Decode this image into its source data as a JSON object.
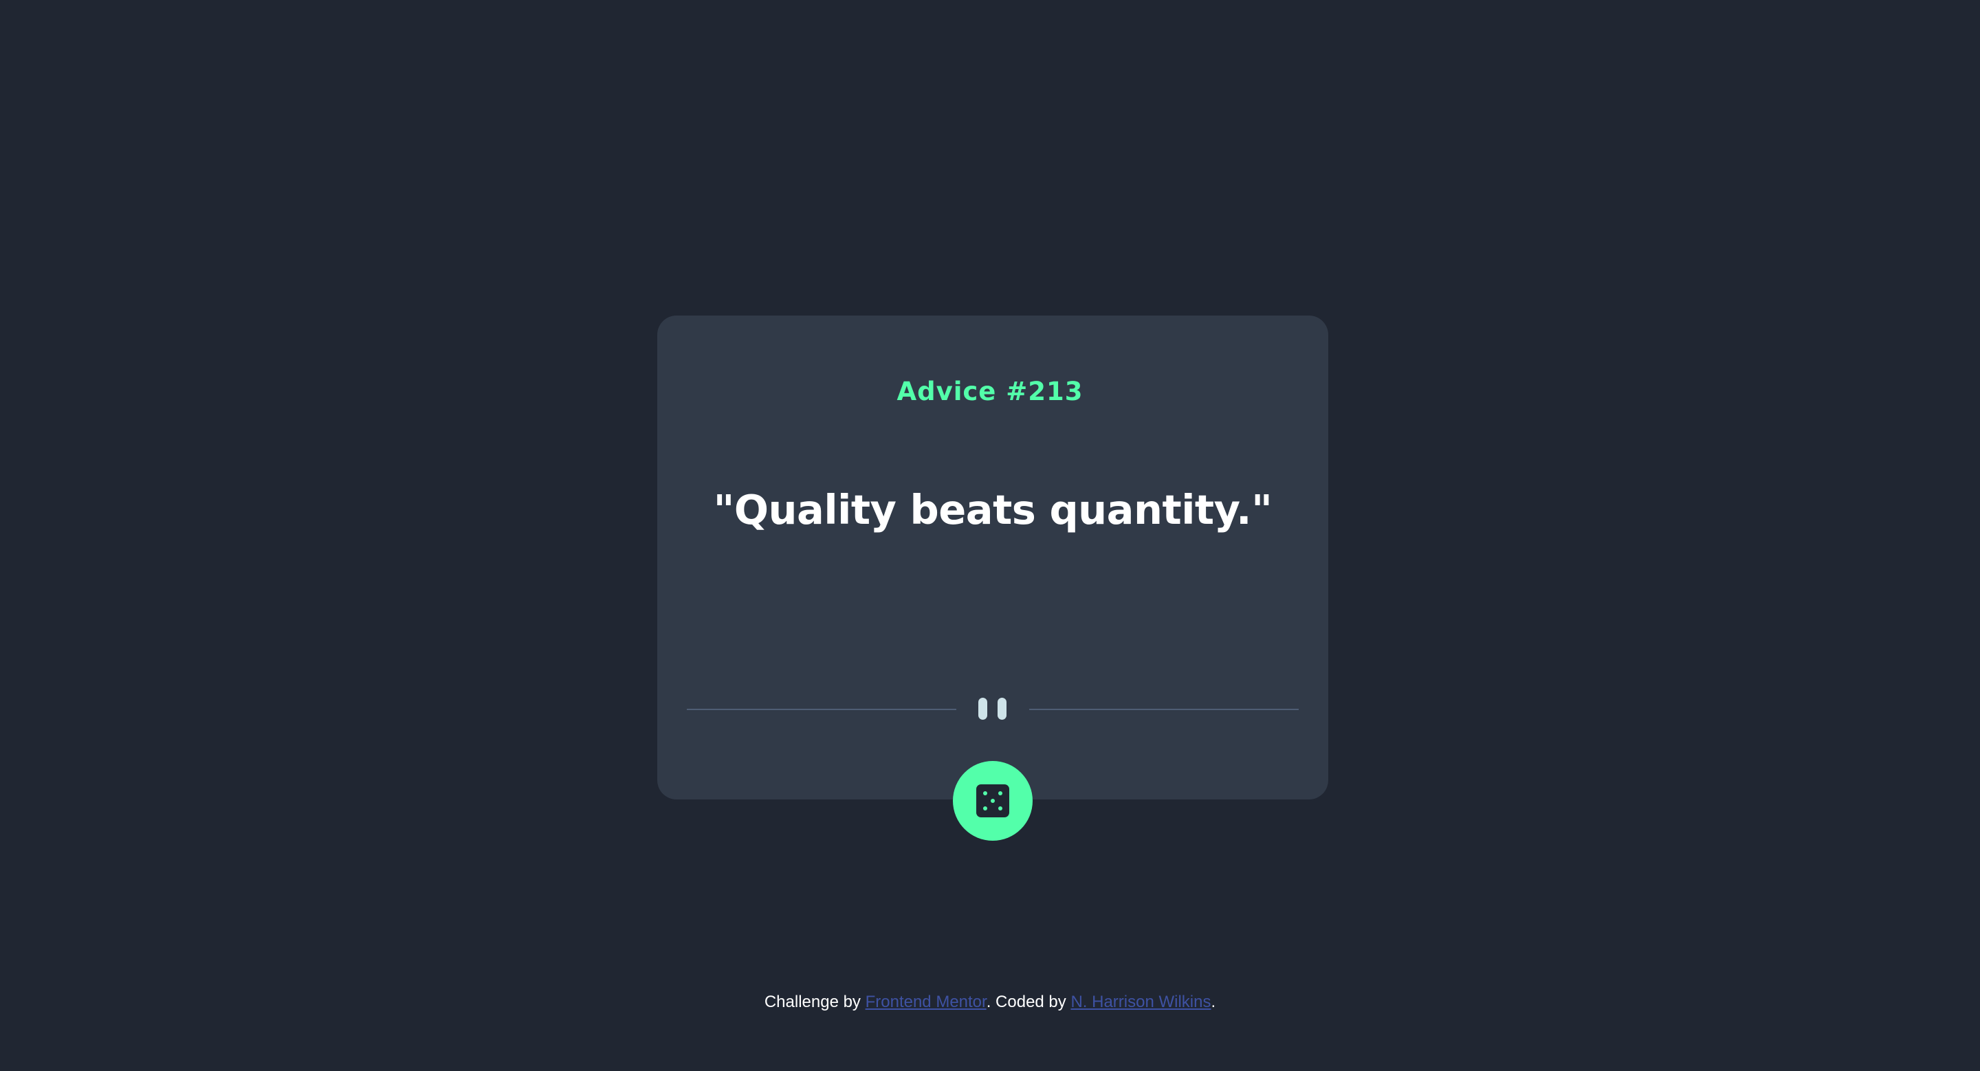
{
  "advice": {
    "id_label": "Advice #213",
    "quote": "\"Quality beats quantity.\""
  },
  "dice_button": {
    "icon": "dice-icon",
    "aria_label": "Generate new advice"
  },
  "divider": {
    "icon": "pause-icon"
  },
  "footer": {
    "challenge_prefix": "Challenge by ",
    "challenge_link": "Frontend Mentor",
    "coded_prefix": ". Coded by ",
    "author_link": "N. Harrison Wilkins",
    "suffix": "."
  },
  "colors": {
    "background": "#202632",
    "card": "#313a48",
    "accent_green": "#53ffaa",
    "divider": "#4f5d74",
    "pause": "#cee3e9",
    "link": "#3e52a3"
  }
}
